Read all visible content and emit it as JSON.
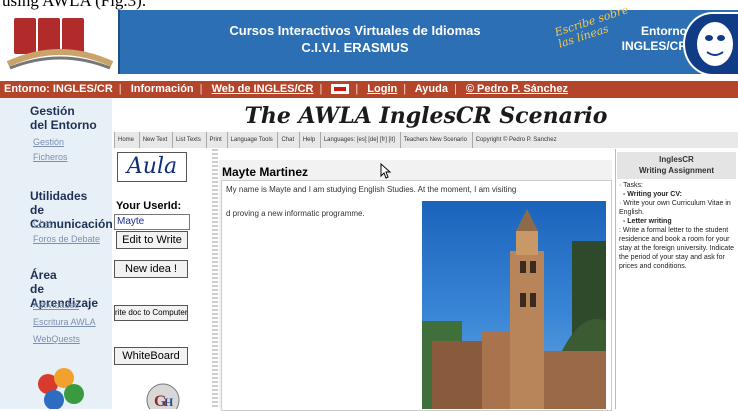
{
  "caption": "using AWLA (Fig.3).",
  "banner": {
    "title_line1": "Cursos Interactivos Virtuales de Idiomas",
    "title_line2": "C.I.V.I. ERASMUS",
    "script_text": "Escribe sobre las líneas",
    "entorno_label": "Entorno",
    "entorno_value": "INGLES/CR"
  },
  "navbar": {
    "entorno": "Entorno: INGLES/CR",
    "items": [
      "Información",
      "Web de INGLES/CR",
      "Login",
      "Ayuda"
    ],
    "copyright": "© Pedro P. Sánchez"
  },
  "sidebar": {
    "section1_title_1": "Gestión",
    "section1_title_2": "del Entorno",
    "section1_links": [
      "Gestión",
      "Ficheros"
    ],
    "section2_title_1": "Utilidades",
    "section2_title_2": "de Comunicación",
    "section2_links": [
      "Chat",
      "Foros de Debate"
    ],
    "section3_title_1": "Área",
    "section3_title_2": "de Aprendizaje",
    "section3_links": [
      "Actividades",
      "Escritura AWLA",
      "WebQuests"
    ]
  },
  "app": {
    "title": "The AWLA InglesCR Scenario",
    "toolbar": [
      "Home",
      "New Text",
      "List Texts",
      "Print",
      "Language Tools",
      "Chat",
      "Help",
      "Languages: [es] [de] [fr] [it]",
      "Teachers New Scenario",
      "Copyright © Pedro P. Sanchez"
    ]
  },
  "controls": {
    "aula_logo": "Aula",
    "userid_label": "Your UserId:",
    "userid_value": "Mayte",
    "edit_button": "Edit to Write",
    "new_idea_button": "New idea !",
    "write_doc_button": "rite doc to Computer",
    "whiteboard_button": "WhiteBoard"
  },
  "content": {
    "author": "Mayte Martinez",
    "line1": "My name is Mayte and I am studying English Studies. At the moment, I am visiting",
    "line2": "d proving a new informatic programme."
  },
  "right_panel": {
    "title_1": "InglesCR",
    "title_2": "Writing Assignment",
    "tasks_label": "· Tasks:",
    "task1_title": "- Writing your CV:",
    "task1_body": "· Write your own Curriculum Vitae in English.",
    "task2_title": "- Letter writing",
    "task2_body": ": Write a formal letter to the student residence and book a room for your stay at the foreign university. Indicate the period of your stay and ask for prices and conditions."
  },
  "colors": {
    "banner_blue": "#2c6fb5",
    "navbar_red": "#b4452a",
    "sidebar_bg": "#e6f0f6"
  }
}
